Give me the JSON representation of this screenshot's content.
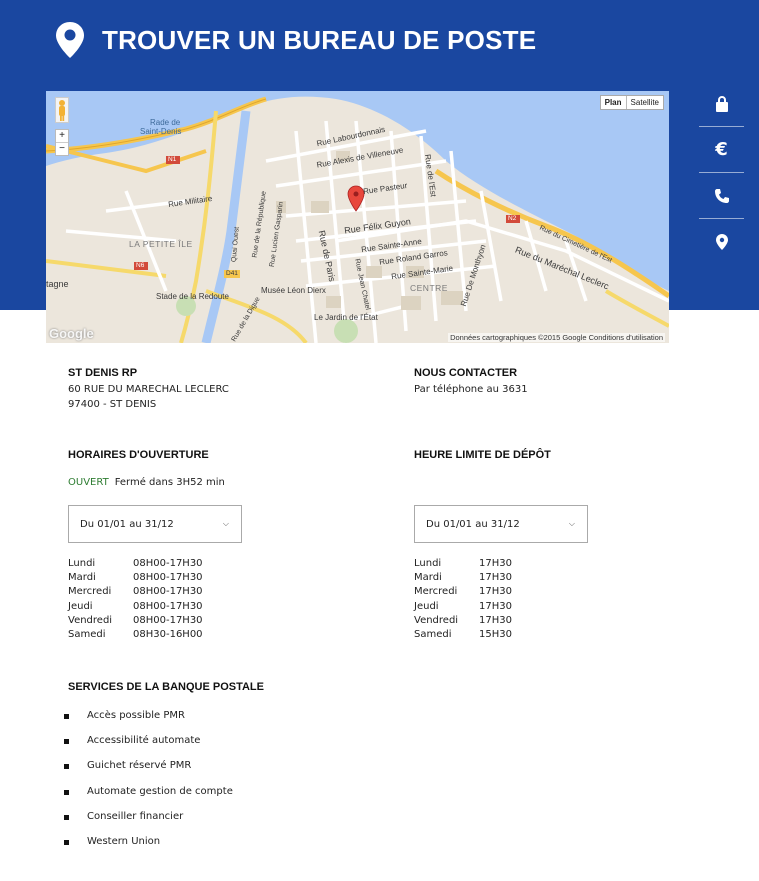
{
  "header": {
    "title": "TROUVER UN BUREAU DE POSTE",
    "accent_color": "#1a47a0"
  },
  "side_icons": [
    "lock-icon",
    "euro-icon",
    "phone-icon",
    "location-pin-icon"
  ],
  "map": {
    "type_buttons": [
      "Plan",
      "Satellite"
    ],
    "zoom_in": "+",
    "zoom_out": "−",
    "logo": "Google",
    "attribution": "Données cartographiques ©2015 Google    Conditions d'utilisation",
    "labels": {
      "rade": "Rade de",
      "saint_denis": "Saint-Denis",
      "labourdonnais": "Rue Labourdonnais",
      "villeneuve": "Rue Alexis de Villeneuve",
      "pasteur": "Rue Pasteur",
      "est": "Rue de l'Est",
      "militaire": "Rue Militaire",
      "petite_ile": "LA PETITE ÎLE",
      "felix_guyon": "Rue Félix Guyon",
      "sainte_anne": "Rue Sainte-Anne",
      "roland_garros": "Rue Roland Garros",
      "sainte_marie": "Rue Sainte-Marie",
      "monthyon": "Rue De Monthyon",
      "marechal_leclerc": "Rue du Maréchal Leclerc",
      "cimetiere": "Rue du Cimetière de l'Est",
      "centre": "CENTRE",
      "gaspard": "Rue Lucien Gasparin",
      "republique": "Rue de la République",
      "paris": "Rue de Paris",
      "jean_chatel": "Rue Jean Chatel",
      "musee": "Musée Léon Dierx",
      "jardin": "Le Jardin de l'État",
      "stade": "Stade de la Redoute",
      "tagne": "tagne",
      "quai": "Quai Ouest",
      "digue": "Rue de la Digue",
      "n1": "N1",
      "n2": "N2",
      "n6": "N6",
      "d41": "D41"
    }
  },
  "office": {
    "name": "ST DENIS RP",
    "address_line1": "60 RUE DU MARECHAL LECLERC",
    "address_line2": "97400 - ST DENIS"
  },
  "contact": {
    "title": "NOUS CONTACTER",
    "text": "Par téléphone au 3631"
  },
  "opening_hours": {
    "title": "HORAIRES D'OUVERTURE",
    "status": "OUVERT",
    "status_color": "#2e7d32",
    "status_detail": "Fermé dans 3H52 min",
    "period": "Du 01/01 au 31/12",
    "rows": [
      {
        "day": "Lundi",
        "hours": "08H00-17H30"
      },
      {
        "day": "Mardi",
        "hours": "08H00-17H30"
      },
      {
        "day": "Mercredi",
        "hours": "08H00-17H30"
      },
      {
        "day": "Jeudi",
        "hours": "08H00-17H30"
      },
      {
        "day": "Vendredi",
        "hours": "08H00-17H30"
      },
      {
        "day": "Samedi",
        "hours": "08H30-16H00"
      }
    ]
  },
  "deposit_limit": {
    "title": "HEURE LIMITE DE DÉPÔT",
    "period": "Du 01/01 au 31/12",
    "rows": [
      {
        "day": "Lundi",
        "hours": "17H30"
      },
      {
        "day": "Mardi",
        "hours": "17H30"
      },
      {
        "day": "Mercredi",
        "hours": "17H30"
      },
      {
        "day": "Jeudi",
        "hours": "17H30"
      },
      {
        "day": "Vendredi",
        "hours": "17H30"
      },
      {
        "day": "Samedi",
        "hours": "15H30"
      }
    ]
  },
  "services": {
    "title": "SERVICES DE LA BANQUE POSTALE",
    "items": [
      "Accès possible PMR",
      "Accessibilité automate",
      "Guichet réservé PMR",
      "Automate gestion de compte",
      "Conseiller financier",
      "Western Union"
    ]
  }
}
